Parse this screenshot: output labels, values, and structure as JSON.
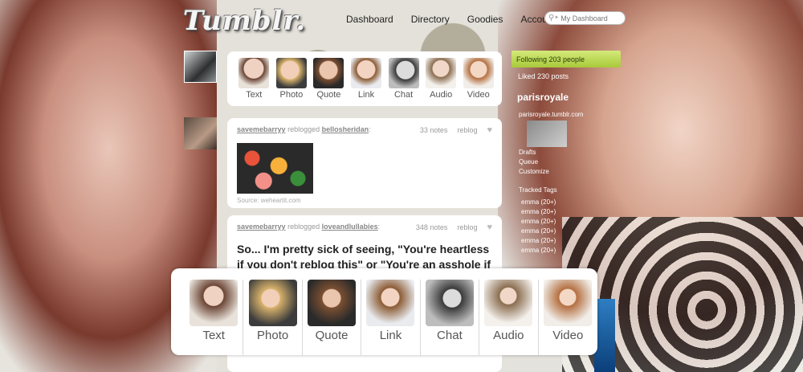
{
  "header": {
    "logo": "Tumblr.",
    "nav": [
      "Dashboard",
      "Directory",
      "Goodies",
      "Account"
    ],
    "search_placeholder": "My Dashboard"
  },
  "post_types_small": [
    "Text",
    "Photo",
    "Quote",
    "Link",
    "Chat",
    "Audio",
    "Video"
  ],
  "post_types_large": [
    "Text",
    "Photo",
    "Quote",
    "Link",
    "Chat",
    "Audio",
    "Video"
  ],
  "posts": [
    {
      "user": "savemebarryy",
      "action": "reblogged",
      "from": "bellosheridan",
      "notes": "33 notes",
      "reblog": "reblog",
      "source": "Source: weheartit.com"
    },
    {
      "user": "savemebarryy",
      "action": "reblogged",
      "from": "loveandlullabies",
      "notes": "348 notes",
      "reblog": "reblog",
      "text": "So... I'm pretty sick of seeing, \"You're heartless if you don't reblog this\" or \"You're an asshole if"
    }
  ],
  "sidebar": {
    "following": "Following 203 people",
    "liked": "Liked 230 posts",
    "username": "parisroyale",
    "blog_url": "parisroyale.tumblr.com",
    "links": [
      "Drafts",
      "Queue",
      "Customize"
    ],
    "tracked_heading": "Tracked Tags",
    "tags": [
      "emma (20+)",
      "emma (20+)",
      "emma (20+)",
      "emma (20+)",
      "emma (20+)",
      "emma (20+)"
    ]
  },
  "colors": {
    "following_bar": "#a9c93a",
    "panel_bg": "#ffffff"
  }
}
